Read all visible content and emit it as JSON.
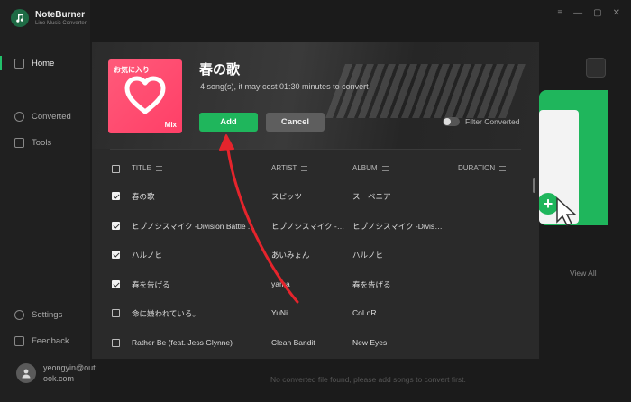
{
  "app": {
    "name": "NoteBurner",
    "subtitle": "Line Music Converter"
  },
  "sidebar": {
    "items": [
      {
        "label": "Home",
        "icon": "home-icon",
        "active": true
      },
      {
        "label": "Converted",
        "icon": "clock-icon",
        "active": false
      },
      {
        "label": "Tools",
        "icon": "toolbox-icon",
        "active": false
      },
      {
        "label": "Settings",
        "icon": "gear-icon",
        "active": false
      },
      {
        "label": "Feedback",
        "icon": "mail-icon",
        "active": false
      }
    ],
    "user_email": "yeongyin@outlook.com"
  },
  "window_controls": [
    "≡",
    "—",
    "▢",
    "✕"
  ],
  "background": {
    "view_all": "View All",
    "empty_message": "No converted file found, please add songs to convert first."
  },
  "modal": {
    "cover": {
      "text": "お気に入り",
      "badge": "Mix"
    },
    "title": "春の歌",
    "info": "4 song(s), it may cost 01:30 minutes to convert",
    "add_label": "Add",
    "cancel_label": "Cancel",
    "filter_label": "Filter Converted",
    "filter_on": false,
    "columns": {
      "title": "TITLE",
      "artist": "ARTIST",
      "album": "ALBUM",
      "duration": "DURATION"
    },
    "rows": [
      {
        "checked": true,
        "title": "春の歌",
        "artist": "スピッツ",
        "album": "スーベニア"
      },
      {
        "checked": true,
        "title": "ヒプノシスマイク -Division Battle Anthem-",
        "artist": "ヒプノシスマイク -Division All Stars-",
        "album": "ヒプノシスマイク -Division Battle Anthem-"
      },
      {
        "checked": true,
        "title": "ハルノヒ",
        "artist": "あいみょん",
        "album": "ハルノヒ"
      },
      {
        "checked": true,
        "title": "春を告げる",
        "artist": "yama",
        "album": "春を告げる"
      },
      {
        "checked": false,
        "title": "命に嫌われている。",
        "artist": "YuNi",
        "album": "CoLoR"
      },
      {
        "checked": false,
        "title": "Rather Be (feat. Jess Glynne)",
        "artist": "Clean Bandit",
        "album": "New Eyes"
      }
    ]
  },
  "colors": {
    "accent": "#1fb65c",
    "background": "#1b1b1b",
    "modal": "#2a2a2a",
    "arrow": "#e5242c"
  }
}
